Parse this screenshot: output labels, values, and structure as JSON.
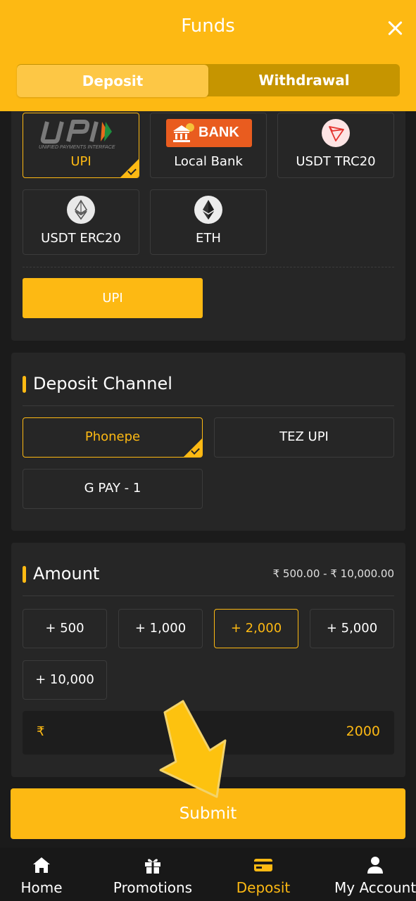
{
  "header": {
    "title": "Funds",
    "tabs": {
      "deposit": "Deposit",
      "withdrawal": "Withdrawal"
    },
    "active_tab": "deposit"
  },
  "methods": [
    {
      "label": "UPI",
      "logo_text": "UNIFIED PAYMENTS INTERFACE",
      "icon": "upi-logo",
      "selected": true
    },
    {
      "label": "Local Bank",
      "logo_text": "BANK",
      "icon": "bank-logo",
      "selected": false
    },
    {
      "label": "USDT TRC20",
      "icon": "tron-icon",
      "selected": false
    },
    {
      "label": "USDT ERC20",
      "icon": "ethereum-icon",
      "selected": false
    },
    {
      "label": "ETH",
      "icon": "ethereum-icon",
      "selected": false
    }
  ],
  "method_sub_option": "UPI",
  "deposit_channel": {
    "title": "Deposit Channel",
    "options": [
      {
        "label": "Phonepe",
        "selected": true
      },
      {
        "label": "TEZ UPI",
        "selected": false
      },
      {
        "label": "G PAY - 1",
        "selected": false
      }
    ]
  },
  "amount": {
    "title": "Amount",
    "range": "₹ 500.00 - ₹ 10,000.00",
    "presets": [
      {
        "label": "+ 500",
        "selected": false
      },
      {
        "label": "+ 1,000",
        "selected": false
      },
      {
        "label": "+ 2,000",
        "selected": true
      },
      {
        "label": "+ 5,000",
        "selected": false
      },
      {
        "label": "+ 10,000",
        "selected": false
      }
    ],
    "currency_symbol": "₹",
    "value": "2000"
  },
  "submit_label": "Submit",
  "bottom_nav": [
    {
      "label": "Home",
      "icon": "home-icon",
      "active": false
    },
    {
      "label": "Promotions",
      "icon": "gift-icon",
      "active": false
    },
    {
      "label": "Deposit",
      "icon": "card-icon",
      "active": true
    },
    {
      "label": "My Account",
      "icon": "user-icon",
      "active": false
    }
  ],
  "colors": {
    "accent": "#fdb913",
    "background": "#1b1b1b",
    "panel": "#262626",
    "border": "#3b3b3b"
  }
}
